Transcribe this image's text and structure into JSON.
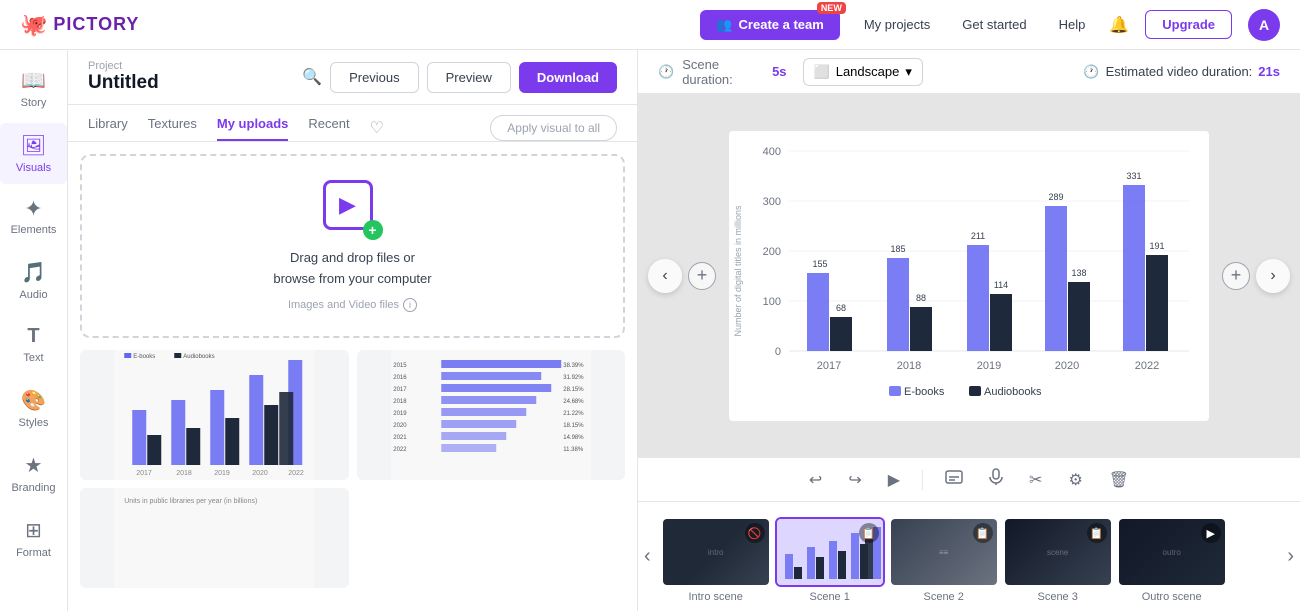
{
  "app": {
    "logo_text": "PICTORY",
    "logo_icon": "🐙"
  },
  "nav": {
    "create_team_label": "Create a team",
    "new_badge": "NEW",
    "my_projects": "My projects",
    "get_started": "Get started",
    "help": "Help",
    "upgrade": "Upgrade",
    "avatar_initial": "A"
  },
  "project": {
    "label": "Project",
    "title": "Untitled"
  },
  "toolbar": {
    "previous_label": "Previous",
    "preview_label": "Preview",
    "download_label": "Download"
  },
  "tabs": {
    "library": "Library",
    "textures": "Textures",
    "my_uploads": "My uploads",
    "recent": "Recent",
    "apply_visual": "Apply visual to all"
  },
  "upload": {
    "drag_text": "Drag and drop files or",
    "browse_text": "browse from your computer",
    "file_types": "Images and Video files"
  },
  "scene_info": {
    "duration_label": "Scene duration:",
    "duration_value": "5s",
    "orientation_label": "Landscape",
    "video_duration_label": "Estimated video duration:",
    "video_duration_value": "21s"
  },
  "chart": {
    "y_axis_label": "Number of digital titles in millions",
    "legend": [
      "E-books",
      "Audiobooks"
    ],
    "x_labels": [
      "2017",
      "2018",
      "2019",
      "2020",
      "2022"
    ],
    "ebook_values": [
      155,
      185,
      211,
      289,
      331
    ],
    "audiobook_values": [
      68,
      88,
      114,
      138,
      191
    ],
    "y_ticks": [
      0,
      100,
      200,
      300,
      400
    ]
  },
  "toolbar_actions": {
    "undo": "↩",
    "redo": "↪",
    "play": "▶",
    "subtitle": "⊟",
    "mic": "🎙",
    "cut": "✂",
    "settings": "⚙",
    "trash": "🗑"
  },
  "timeline": {
    "scenes": [
      {
        "label": "Intro scene",
        "type": "intro"
      },
      {
        "label": "Scene 1",
        "type": "scene1",
        "active": true
      },
      {
        "label": "Scene 2",
        "type": "scene2"
      },
      {
        "label": "Scene 3",
        "type": "scene3"
      },
      {
        "label": "Outro scene",
        "type": "outro"
      }
    ]
  },
  "sidebar": {
    "items": [
      {
        "id": "story",
        "label": "Story",
        "icon": "📖"
      },
      {
        "id": "visuals",
        "label": "Visuals",
        "icon": "🖼",
        "active": true
      },
      {
        "id": "elements",
        "label": "Elements",
        "icon": "✦"
      },
      {
        "id": "audio",
        "label": "Audio",
        "icon": "🎵"
      },
      {
        "id": "text",
        "label": "Text",
        "icon": "T"
      },
      {
        "id": "styles",
        "label": "Styles",
        "icon": "🎨"
      },
      {
        "id": "branding",
        "label": "Branding",
        "icon": "★"
      },
      {
        "id": "format",
        "label": "Format",
        "icon": "⊞"
      }
    ]
  }
}
